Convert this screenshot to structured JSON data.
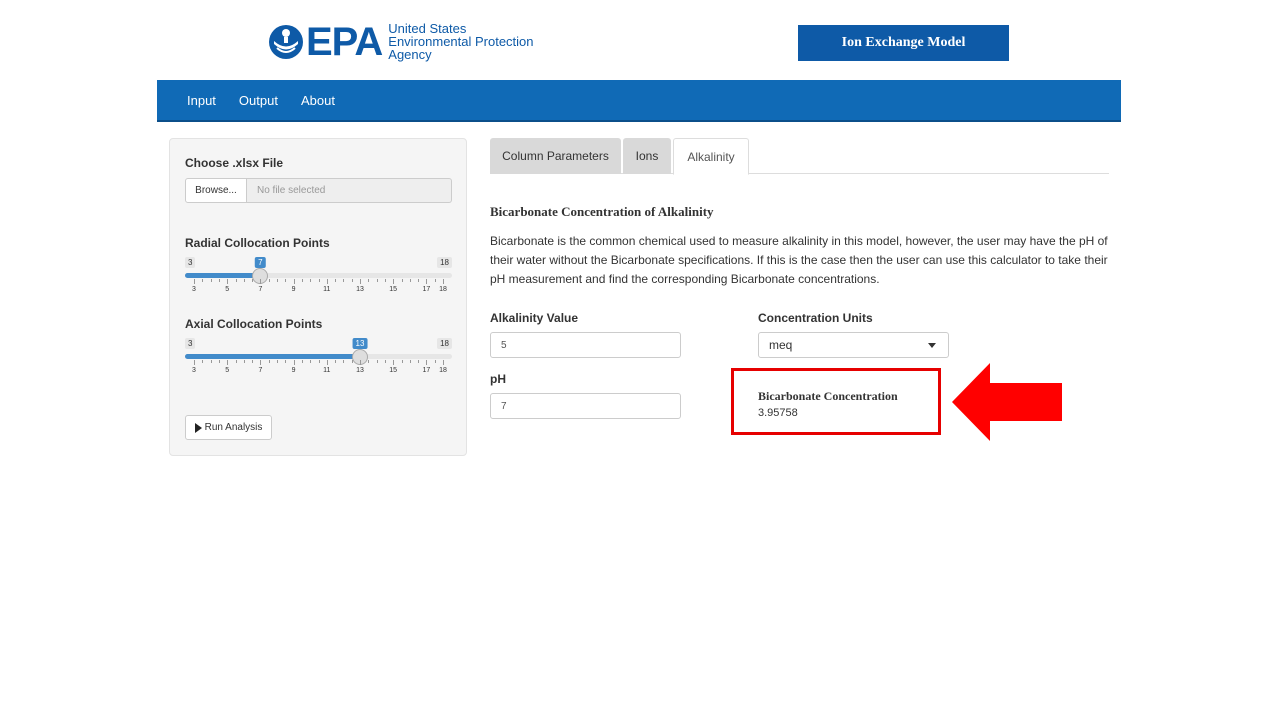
{
  "brand": {
    "mark": "EPA",
    "line1": "United States",
    "line2": "Environmental Protection",
    "line3": "Agency",
    "app_title": "Ion Exchange Model",
    "color": "#0e5aa7"
  },
  "nav": {
    "items": [
      "Input",
      "Output",
      "About"
    ],
    "color": "#106ab6"
  },
  "sidebar": {
    "file_label": "Choose .xlsx File",
    "browse_label": "Browse...",
    "file_placeholder": "No file selected",
    "radial": {
      "label": "Radial Collocation Points",
      "min": 3,
      "max": 18,
      "value": 7,
      "min_label": "3",
      "max_label": "18",
      "value_label": "7",
      "tick_labels": [
        "3",
        "5",
        "7",
        "9",
        "11",
        "13",
        "15",
        "17",
        "18"
      ]
    },
    "axial": {
      "label": "Axial Collocation Points",
      "min": 3,
      "max": 18,
      "value": 13,
      "min_label": "3",
      "max_label": "18",
      "value_label": "13",
      "tick_labels": [
        "3",
        "5",
        "7",
        "9",
        "11",
        "13",
        "15",
        "17",
        "18"
      ]
    },
    "run_label": "Run Analysis"
  },
  "tabs": {
    "items": [
      "Column Parameters",
      "Ions",
      "Alkalinity"
    ],
    "active": "Alkalinity"
  },
  "main": {
    "title": "Bicarbonate Concentration of Alkalinity",
    "paragraph": "Bicarbonate is the common chemical used to measure alkalinity in this model, however, the user may have the pH of their water without the Bicarbonate specifications. If this is the case then the user can use this calculator to take their pH measurement and find the corresponding Bicarbonate concentrations.",
    "alkalinity_label": "Alkalinity Value",
    "alkalinity_value": "5",
    "ph_label": "pH",
    "ph_value": "7",
    "units_label": "Concentration Units",
    "units_value": "meq",
    "result_label": "Bicarbonate Concentration",
    "result_value": "3.95758"
  },
  "annotation": {
    "highlight_color": "#e60000"
  }
}
